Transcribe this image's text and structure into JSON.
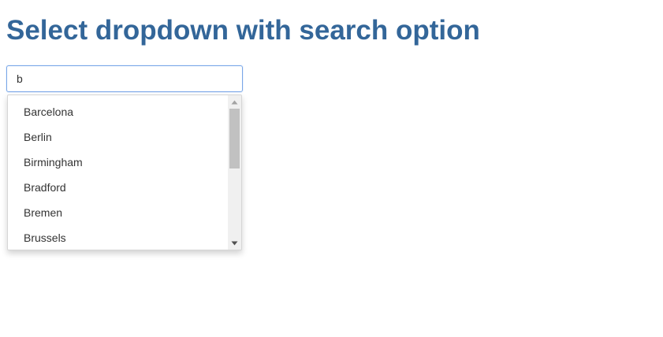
{
  "page": {
    "title": "Select dropdown with search option"
  },
  "search": {
    "value": "b"
  },
  "dropdown": {
    "options": [
      "Barcelona",
      "Berlin",
      "Birmingham",
      "Bradford",
      "Bremen",
      "Brussels"
    ]
  },
  "icons": {
    "scroll_up": "triangle-up-icon",
    "scroll_down": "triangle-down-icon"
  },
  "colors": {
    "title": "#336699",
    "focus_border": "#7aa7e8",
    "option_text": "#333333"
  }
}
